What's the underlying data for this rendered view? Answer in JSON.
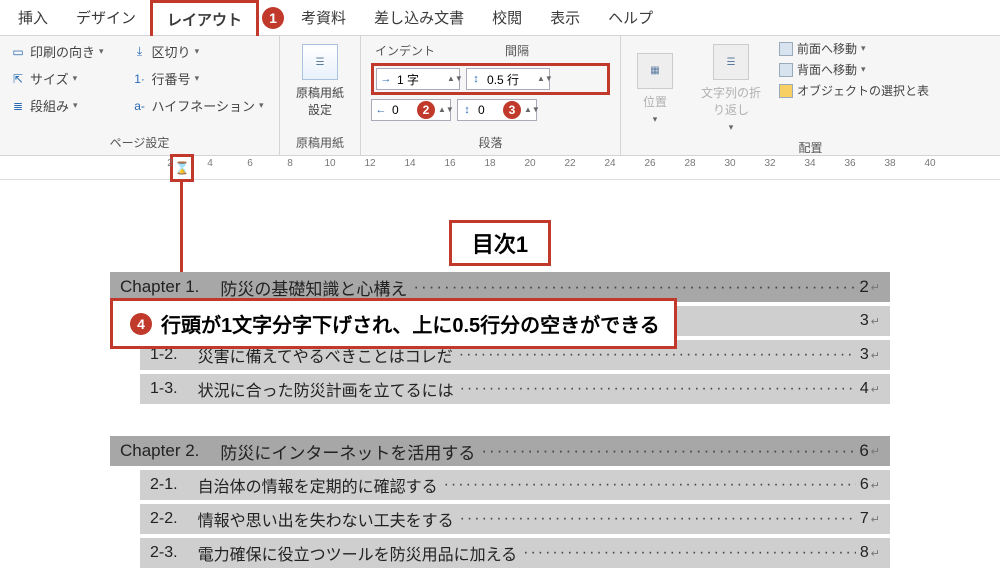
{
  "menu": {
    "items": [
      "挿入",
      "デザイン",
      "レイアウト",
      "参考資料",
      "差し込み文書",
      "校閲",
      "表示",
      "ヘルプ"
    ],
    "active_index": 2,
    "callout1": "1",
    "ref_partial": "考資料"
  },
  "ribbon": {
    "page_setup": {
      "orientation": "印刷の向き",
      "size": "サイズ",
      "columns": "段組み",
      "breaks": "区切り",
      "line_numbers": "行番号",
      "hyphenation": "ハイフネーション",
      "group": "ページ設定"
    },
    "manuscript": {
      "button": "原稿用紙\n設定",
      "group": "原稿用紙"
    },
    "paragraph": {
      "indent_label": "インデント",
      "spacing_label": "間隔",
      "left_indent": "1 字",
      "before_spacing": "0.5 行",
      "right_indent": "0 字",
      "after_spacing": "0 行",
      "callout2": "2",
      "callout3": "3",
      "group": "段落"
    },
    "arrange": {
      "position": "位置",
      "wrap": "文字列の折\nり返し",
      "bring_fwd": "前面へ移動",
      "send_back": "背面へ移動",
      "selection": "オブジェクトの選択と表",
      "group": "配置"
    }
  },
  "ruler": {
    "ticks": [
      2,
      4,
      6,
      8,
      10,
      12,
      14,
      16,
      18,
      20,
      22,
      24,
      26,
      28,
      30,
      32,
      34,
      36,
      38,
      40
    ]
  },
  "doc": {
    "heading": "目次1",
    "annot_num": "4",
    "annot_text": "行頭が1文字分字下げされ、上に0.5行分の空きができる",
    "lines": [
      {
        "type": "chapter",
        "lead": "Chapter 1.",
        "title": "防災の基礎知識と心構え",
        "page": "2"
      },
      {
        "type": "hidden_sub",
        "title": "",
        "page": ""
      },
      {
        "type": "sub",
        "lead": "1-2.",
        "title": "災害に備えてやるべきことはコレだ",
        "page": "3"
      },
      {
        "type": "sub",
        "lead": "1-3.",
        "title": "状況に合った防災計画を立てるには",
        "page": "4"
      },
      {
        "type": "chapter",
        "lead": "Chapter 2.",
        "title": "防災にインターネットを活用する",
        "page": "6"
      },
      {
        "type": "sub",
        "lead": "2-1.",
        "title": "自治体の情報を定期的に確認する",
        "page": "6"
      },
      {
        "type": "sub",
        "lead": "2-2.",
        "title": "情報や思い出を失わない工夫をする",
        "page": "7"
      },
      {
        "type": "sub",
        "lead": "2-3.",
        "title": "電力確保に役立つツールを防災用品に加える",
        "page": "8"
      }
    ],
    "dots": "································································"
  }
}
